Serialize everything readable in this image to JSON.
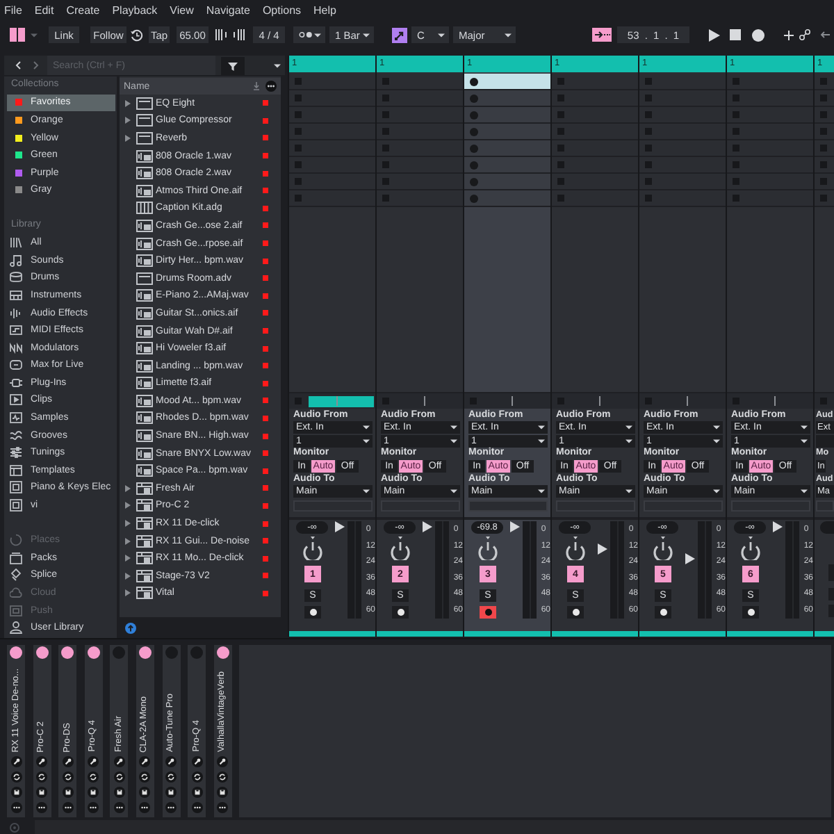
{
  "menu": [
    "File",
    "Edit",
    "Create",
    "Playback",
    "View",
    "Navigate",
    "Options",
    "Help"
  ],
  "control_bar": {
    "link": "Link",
    "follow": "Follow",
    "tap": "Tap",
    "tempo": "65.00",
    "signature": "4 / 4",
    "quantization": "1 Bar",
    "key": "C",
    "scale": "Major",
    "position": "53 . 1 . 1"
  },
  "browser": {
    "search": {
      "placeholder": "Search (Ctrl + F)"
    },
    "collections_heading": "Collections",
    "collections": [
      {
        "label": "Favorites",
        "color": "#ff1a1a",
        "selected": true
      },
      {
        "label": "Orange",
        "color": "#ff9a1e",
        "selected": false
      },
      {
        "label": "Yellow",
        "color": "#f2ee1e",
        "selected": false
      },
      {
        "label": "Green",
        "color": "#1ee68c",
        "selected": false
      },
      {
        "label": "Purple",
        "color": "#b05cf0",
        "selected": false
      },
      {
        "label": "Gray",
        "color": "#8a8a8a",
        "selected": false
      }
    ],
    "library_heading": "Library",
    "library": [
      {
        "label": "All",
        "selected": false
      },
      {
        "label": "Sounds",
        "selected": false
      },
      {
        "label": "Drums",
        "selected": false
      },
      {
        "label": "Instruments",
        "selected": false
      },
      {
        "label": "Audio Effects",
        "selected": false
      },
      {
        "label": "MIDI Effects",
        "selected": false
      },
      {
        "label": "Modulators",
        "selected": false
      },
      {
        "label": "Max for Live",
        "selected": false
      },
      {
        "label": "Plug-Ins",
        "selected": false
      },
      {
        "label": "Clips",
        "selected": false
      },
      {
        "label": "Samples",
        "selected": false
      },
      {
        "label": "Grooves",
        "selected": false
      },
      {
        "label": "Tunings",
        "selected": false
      },
      {
        "label": "Templates",
        "selected": false
      },
      {
        "label": "Piano & Keys Elec",
        "selected": false
      },
      {
        "label": "vi",
        "selected": false
      }
    ],
    "places": [
      {
        "label": "Places",
        "disabled": true
      },
      {
        "label": "Packs",
        "disabled": false
      },
      {
        "label": "Splice",
        "disabled": false
      },
      {
        "label": "Cloud",
        "disabled": true
      },
      {
        "label": "Push",
        "disabled": true
      },
      {
        "label": "User Library",
        "disabled": false
      }
    ],
    "name_heading": "Name",
    "files": [
      {
        "name": "EQ Eight",
        "kind": "device",
        "expandable": true,
        "color": "#ff1a1a"
      },
      {
        "name": "Glue Compressor",
        "kind": "device",
        "expandable": true,
        "color": "#ff1a1a"
      },
      {
        "name": "Reverb",
        "kind": "device",
        "expandable": true,
        "color": "#ff1a1a"
      },
      {
        "name": "808 Oracle 1.wav",
        "kind": "sample",
        "expandable": false,
        "color": "#ff1a1a"
      },
      {
        "name": "808 Oracle 2.wav",
        "kind": "sample",
        "expandable": false,
        "color": "#ff1a1a"
      },
      {
        "name": "Atmos Third One.aif",
        "kind": "sample",
        "expandable": false,
        "color": "#ff1a1a"
      },
      {
        "name": "Caption Kit.adg",
        "kind": "rack",
        "expandable": false,
        "color": "#ff1a1a"
      },
      {
        "name": "Crash Ge...ose 2.aif",
        "kind": "sample",
        "expandable": false,
        "color": "#ff1a1a"
      },
      {
        "name": "Crash Ge...rpose.aif",
        "kind": "sample",
        "expandable": false,
        "color": "#ff1a1a"
      },
      {
        "name": "Dirty Her... bpm.wav",
        "kind": "sample",
        "expandable": false,
        "color": "#ff1a1a"
      },
      {
        "name": "Drums Room.adv",
        "kind": "device",
        "expandable": false,
        "color": "#ff1a1a"
      },
      {
        "name": "E-Piano 2...AMaj.wav",
        "kind": "sample",
        "expandable": false,
        "color": "#ff1a1a"
      },
      {
        "name": "Guitar St...onics.aif",
        "kind": "sample",
        "expandable": false,
        "color": "#ff1a1a"
      },
      {
        "name": "Guitar Wah D#.aif",
        "kind": "sample",
        "expandable": false,
        "color": "#ff1a1a"
      },
      {
        "name": "Hi Voweler f3.aif",
        "kind": "sample",
        "expandable": false,
        "color": "#ff1a1a"
      },
      {
        "name": "Landing ... bpm.wav",
        "kind": "sample",
        "expandable": false,
        "color": "#ff1a1a"
      },
      {
        "name": "Limette f3.aif",
        "kind": "sample",
        "expandable": false,
        "color": "#ff1a1a"
      },
      {
        "name": "Mood At... bpm.wav",
        "kind": "sample",
        "expandable": false,
        "color": "#ff1a1a"
      },
      {
        "name": "Rhodes D... bpm.wav",
        "kind": "sample",
        "expandable": false,
        "color": "#ff1a1a"
      },
      {
        "name": "Snare BN... High.wav",
        "kind": "sample",
        "expandable": false,
        "color": "#ff1a1a"
      },
      {
        "name": "Snare BNYX Low.wav",
        "kind": "sample",
        "expandable": false,
        "color": "#ff1a1a"
      },
      {
        "name": "Space Pa... bpm.wav",
        "kind": "sample",
        "expandable": false,
        "color": "#ff1a1a"
      },
      {
        "name": "Fresh Air",
        "kind": "plugin",
        "expandable": true,
        "color": "#ff1a1a"
      },
      {
        "name": "Pro-C 2",
        "kind": "plugin",
        "expandable": true,
        "color": "#ff1a1a"
      },
      {
        "name": "RX 11 De-click",
        "kind": "plugin",
        "expandable": true,
        "color": "#ff1a1a"
      },
      {
        "name": "RX 11 Gui... De-noise",
        "kind": "plugin",
        "expandable": true,
        "color": "#ff1a1a"
      },
      {
        "name": "RX 11 Mo... De-click",
        "kind": "plugin",
        "expandable": true,
        "color": "#ff1a1a"
      },
      {
        "name": "Stage-73 V2",
        "kind": "plugin",
        "expandable": true,
        "color": "#ff1a1a"
      },
      {
        "name": "Vital",
        "kind": "plugin",
        "expandable": true,
        "color": "#ff1a1a"
      }
    ]
  },
  "session": {
    "tracks": [
      {
        "title": "1",
        "selected": false,
        "armed": false,
        "slots": [
          {
            "selected": false
          },
          {
            "selected": false
          },
          {
            "selected": false
          },
          {
            "selected": false
          },
          {
            "selected": false
          },
          {
            "selected": false
          },
          {
            "selected": false
          },
          {
            "selected": false
          }
        ],
        "clip_active": true,
        "audio_from_label": "Audio From",
        "audio_from": "Ext. In",
        "input_channel": "1",
        "monitor_label": "Monitor",
        "monitor": [
          {
            "label": "In",
            "selected": false
          },
          {
            "label": "Auto",
            "selected": true
          },
          {
            "label": "Off",
            "selected": false
          }
        ],
        "audio_to_label": "Audio To",
        "audio_to": "Main",
        "volume": "-∞",
        "fader": {
          "level": 1
        },
        "number": "1",
        "solo": "S",
        "scale": [
          "0",
          "12",
          "24",
          "36",
          "48",
          "60"
        ]
      },
      {
        "title": "1",
        "selected": false,
        "armed": false,
        "slots": [
          {
            "selected": false
          },
          {
            "selected": false
          },
          {
            "selected": false
          },
          {
            "selected": false
          },
          {
            "selected": false
          },
          {
            "selected": false
          },
          {
            "selected": false
          },
          {
            "selected": false
          }
        ],
        "clip_active": false,
        "audio_from_label": "Audio From",
        "audio_from": "Ext. In",
        "input_channel": "1",
        "monitor_label": "Monitor",
        "monitor": [
          {
            "label": "In",
            "selected": false
          },
          {
            "label": "Auto",
            "selected": true
          },
          {
            "label": "Off",
            "selected": false
          }
        ],
        "audio_to_label": "Audio To",
        "audio_to": "Main",
        "volume": "-∞",
        "fader": {
          "level": 1
        },
        "number": "2",
        "solo": "S",
        "scale": [
          "0",
          "12",
          "24",
          "36",
          "48",
          "60"
        ]
      },
      {
        "title": "1",
        "selected": true,
        "armed": true,
        "slots": [
          {
            "selected": true
          },
          {
            "selected": false
          },
          {
            "selected": false
          },
          {
            "selected": false
          },
          {
            "selected": false
          },
          {
            "selected": false
          },
          {
            "selected": false
          },
          {
            "selected": false
          }
        ],
        "clip_active": false,
        "audio_from_label": "Audio From",
        "audio_from": "Ext. In",
        "input_channel": "1",
        "monitor_label": "Monitor",
        "monitor": [
          {
            "label": "In",
            "selected": false
          },
          {
            "label": "Auto",
            "selected": true
          },
          {
            "label": "Off",
            "selected": false
          }
        ],
        "audio_to_label": "Audio To",
        "audio_to": "Main",
        "volume": "-69.8",
        "fader": {
          "level": 1
        },
        "number": "3",
        "solo": "S",
        "scale": [
          "0",
          "12",
          "24",
          "36",
          "48",
          "60"
        ]
      },
      {
        "title": "1",
        "selected": false,
        "armed": false,
        "slots": [
          {
            "selected": false
          },
          {
            "selected": false
          },
          {
            "selected": false
          },
          {
            "selected": false
          },
          {
            "selected": false
          },
          {
            "selected": false
          },
          {
            "selected": false
          },
          {
            "selected": false
          }
        ],
        "clip_active": false,
        "audio_from_label": "Audio From",
        "audio_from": "Ext. In",
        "input_channel": "1",
        "monitor_label": "Monitor",
        "monitor": [
          {
            "label": "In",
            "selected": false
          },
          {
            "label": "Auto",
            "selected": true
          },
          {
            "label": "Off",
            "selected": false
          }
        ],
        "audio_to_label": "Audio To",
        "audio_to": "Main",
        "volume": "-∞",
        "fader": {
          "level": 0.74
        },
        "number": "4",
        "solo": "S",
        "scale": [
          "0",
          "12",
          "24",
          "36",
          "48",
          "60"
        ]
      },
      {
        "title": "1",
        "selected": false,
        "armed": false,
        "slots": [
          {
            "selected": false
          },
          {
            "selected": false
          },
          {
            "selected": false
          },
          {
            "selected": false
          },
          {
            "selected": false
          },
          {
            "selected": false
          },
          {
            "selected": false
          },
          {
            "selected": false
          }
        ],
        "clip_active": false,
        "audio_from_label": "Audio From",
        "audio_from": "Ext. In",
        "input_channel": "1",
        "monitor_label": "Monitor",
        "monitor": [
          {
            "label": "In",
            "selected": false
          },
          {
            "label": "Auto",
            "selected": true
          },
          {
            "label": "Off",
            "selected": false
          }
        ],
        "audio_to_label": "Audio To",
        "audio_to": "Main",
        "volume": "-∞",
        "fader": {
          "level": 0.63
        },
        "number": "5",
        "solo": "S",
        "scale": [
          "0",
          "12",
          "24",
          "36",
          "48",
          "60"
        ]
      },
      {
        "title": "1",
        "selected": false,
        "armed": false,
        "slots": [
          {
            "selected": false
          },
          {
            "selected": false
          },
          {
            "selected": false
          },
          {
            "selected": false
          },
          {
            "selected": false
          },
          {
            "selected": false
          },
          {
            "selected": false
          },
          {
            "selected": false
          }
        ],
        "clip_active": false,
        "audio_from_label": "Audio From",
        "audio_from": "Ext. In",
        "input_channel": "1",
        "monitor_label": "Monitor",
        "monitor": [
          {
            "label": "In",
            "selected": false
          },
          {
            "label": "Auto",
            "selected": true
          },
          {
            "label": "Off",
            "selected": false
          }
        ],
        "audio_to_label": "Audio To",
        "audio_to": "Main",
        "volume": "-∞",
        "fader": {
          "level": 1
        },
        "number": "6",
        "solo": "S",
        "scale": [
          "0",
          "12",
          "24",
          "36",
          "48",
          "60"
        ]
      }
    ],
    "partial_track": {
      "title": "1",
      "slots": [
        {
          "selected": false
        },
        {
          "selected": false
        },
        {
          "selected": false
        },
        {
          "selected": false
        },
        {
          "selected": false
        },
        {
          "selected": false
        },
        {
          "selected": false
        },
        {
          "selected": false
        }
      ],
      "audio_from_label": "Aud",
      "audio_from": "Ext",
      "monitor_label": "Mo",
      "monitor_in": "In",
      "audio_to_label": "Aud",
      "audio_to": "Ma"
    }
  },
  "devices": [
    {
      "name": "RX 11 Voice De-no...",
      "on": true
    },
    {
      "name": "Pro-C 2",
      "on": true
    },
    {
      "name": "Pro-DS",
      "on": true
    },
    {
      "name": "Pro-Q 4",
      "on": true
    },
    {
      "name": "Fresh Air",
      "on": false
    },
    {
      "name": "CLA-2A Mono",
      "on": true
    },
    {
      "name": "Auto-Tune Pro",
      "on": false
    },
    {
      "name": "Pro-Q 4",
      "on": false
    },
    {
      "name": "ValhallaVintageVerb",
      "on": true
    }
  ]
}
